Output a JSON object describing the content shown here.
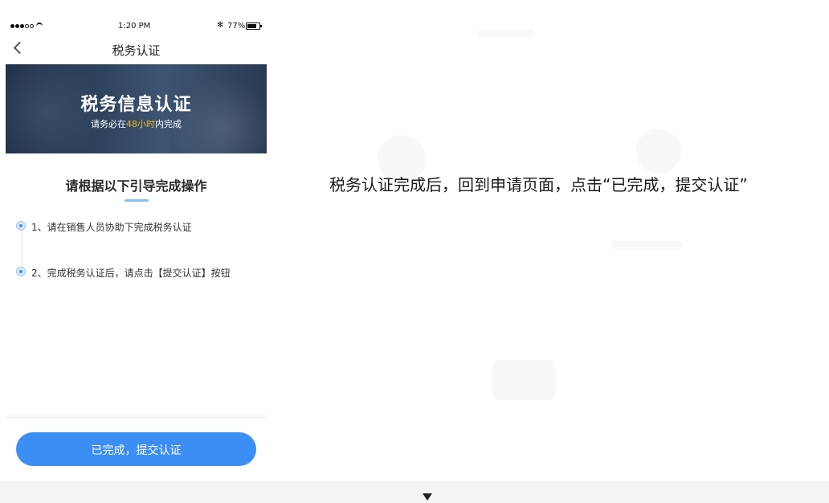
{
  "status_bar": {
    "time": "1:20 PM",
    "bluetooth_glyph": "✻",
    "battery_percent": "77%"
  },
  "nav": {
    "title": "税务认证"
  },
  "banner": {
    "title": "税务信息认证",
    "subtitle_prefix": "请务必在",
    "subtitle_highlight": "48小时",
    "subtitle_suffix": "内完成",
    "highlight_color": "#f2b22a"
  },
  "guide": {
    "title": "请根据以下引导完成操作",
    "steps": [
      {
        "text": "1、请在销售人员协助下完成税务认证"
      },
      {
        "text": "2、完成税务认证后，请点击【提交认证】按钮"
      }
    ]
  },
  "actions": {
    "submit_label": "已完成，提交认证",
    "submit_color": "#3d8ef4"
  },
  "instruction": {
    "text": "税务认证完成后，回到申请页面，点击“已完成，提交认证”"
  },
  "icons": {
    "back": "chevron-left-icon",
    "down": "triangle-down-icon"
  }
}
